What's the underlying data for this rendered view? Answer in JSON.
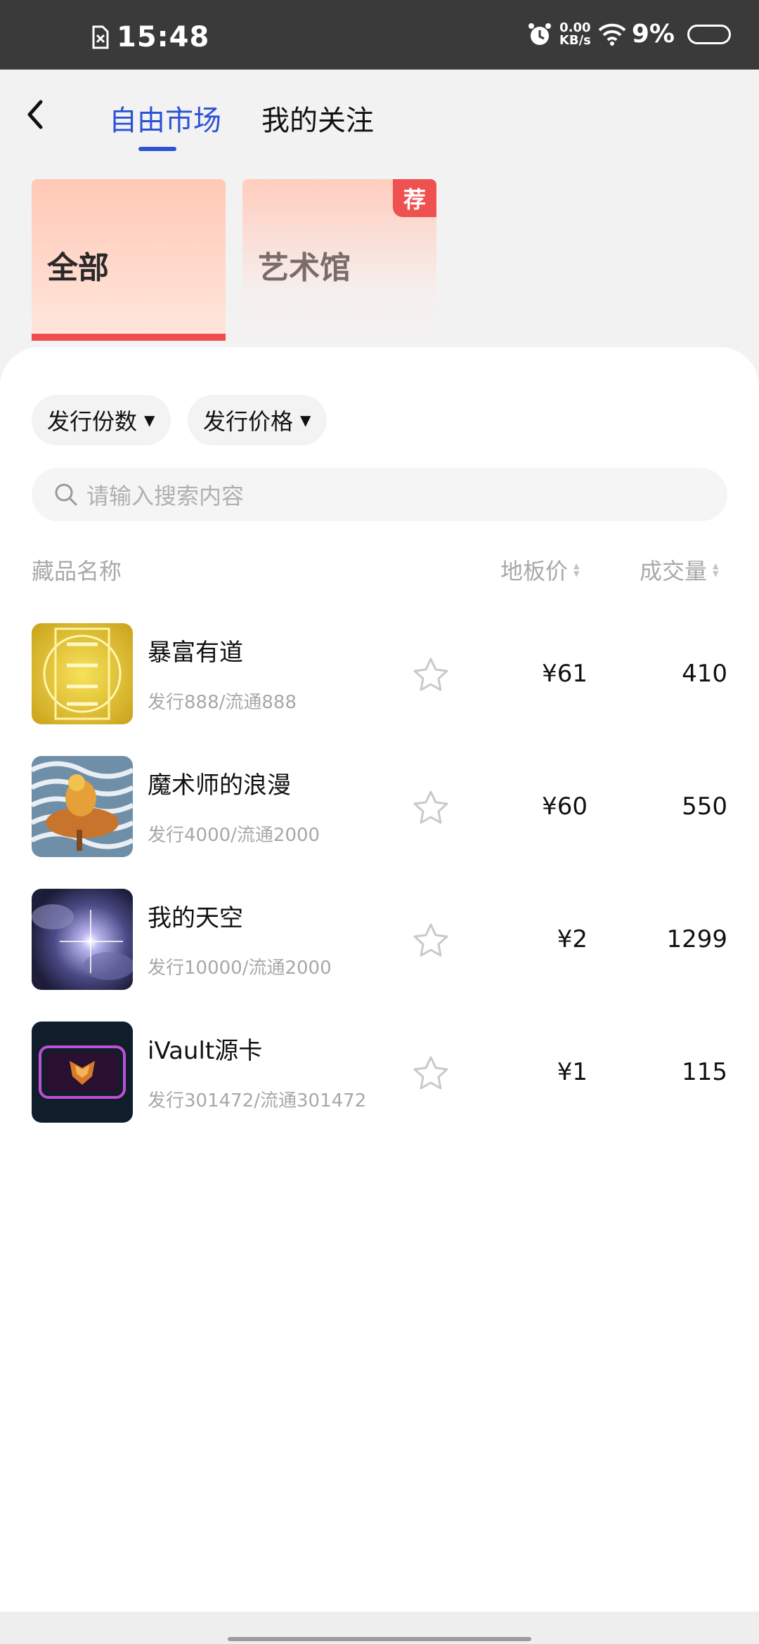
{
  "status_bar": {
    "time": "15:48",
    "net_speed_value": "0.00",
    "net_speed_unit": "KB/s",
    "battery": "9%"
  },
  "header": {
    "tabs": [
      {
        "label": "自由市场",
        "active": true
      },
      {
        "label": "我的关注",
        "active": false
      }
    ]
  },
  "categories": [
    {
      "label": "全部",
      "selected": true
    },
    {
      "label": "艺术馆",
      "badge": "荐"
    }
  ],
  "filters": [
    {
      "label": "发行份数"
    },
    {
      "label": "发行价格"
    }
  ],
  "search": {
    "placeholder": "请输入搜索内容"
  },
  "columns": {
    "name": "藏品名称",
    "floor_price": "地板价",
    "volume": "成交量"
  },
  "items": [
    {
      "name": "暴富有道",
      "sub": "发行888/流通888",
      "price": "¥61",
      "volume": "410"
    },
    {
      "name": "魔术师的浪漫",
      "sub": "发行4000/流通2000",
      "price": "¥60",
      "volume": "550"
    },
    {
      "name": "我的天空",
      "sub": "发行10000/流通2000",
      "price": "¥2",
      "volume": "1299"
    },
    {
      "name": "iVault源卡",
      "sub": "发行301472/流通301472",
      "price": "¥1",
      "volume": "115"
    }
  ],
  "colors": {
    "accent": "#2d52d6",
    "category_bar": "#ee4d4d",
    "badge": "#ef5050"
  }
}
